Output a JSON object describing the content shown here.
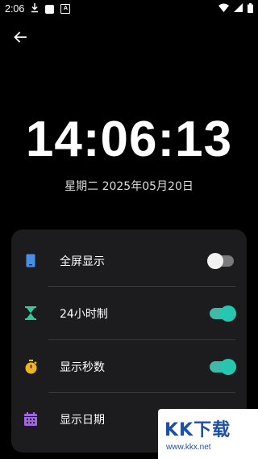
{
  "status_bar": {
    "time": "2:06"
  },
  "clock": {
    "time": "14:06:13",
    "date": "星期二 2025年05月20日"
  },
  "settings": [
    {
      "label": "全屏显示",
      "icon": "phone-icon",
      "toggle": "off",
      "icon_color": "#4a8fe7"
    },
    {
      "label": "24小时制",
      "icon": "hourglass-icon",
      "toggle": "on",
      "icon_color": "#2ecc9a"
    },
    {
      "label": "显示秒数",
      "icon": "stopwatch-icon",
      "toggle": "on",
      "icon_color": "#f0b323"
    },
    {
      "label": "显示日期",
      "icon": "calendar-icon",
      "toggle": "none",
      "icon_color": "#a066e0"
    }
  ],
  "watermark": {
    "logo": "KK下载",
    "url": "www.kkx.net"
  },
  "colors": {
    "background": "#000000",
    "card": "#1c1c1e",
    "toggle_on": "#26c6b0",
    "toggle_off": "#7a7a7a"
  }
}
